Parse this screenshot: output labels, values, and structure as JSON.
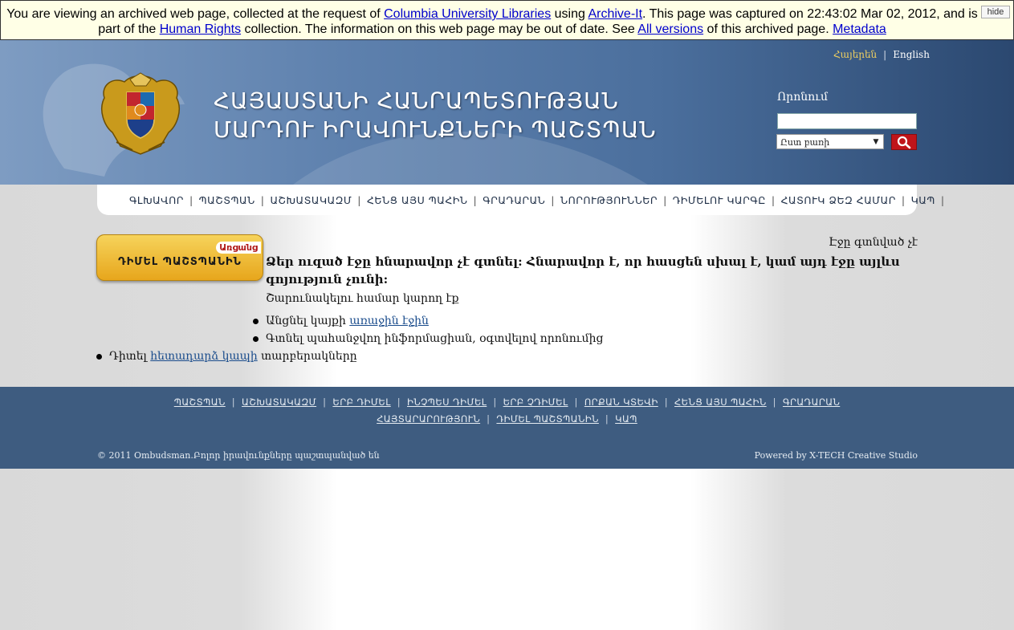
{
  "archive_banner": {
    "text_1": "You are viewing an archived web page, collected at the request of ",
    "link_columbia": "Columbia University Libraries",
    "text_2": " using ",
    "link_archiveit": "Archive-It",
    "text_3": ". This page was captured on 22:43:02 Mar 02, 2012, and is part of the ",
    "link_collection": "Human Rights",
    "text_4": " collection. The information on this web page may be out of date. See ",
    "link_versions": "All versions",
    "text_5": " of this archived page. ",
    "link_metadata": "Metadata",
    "hide_label": "hide"
  },
  "header": {
    "lang_hy": "Հայերեն",
    "lang_sep": "|",
    "lang_en": "English",
    "title_line1": "ՀԱՅԱՍՏԱՆԻ ՀԱՆՐԱՊԵՏՈՒԹՅԱՆ",
    "title_line2": "ՄԱՐԴՈՒ ԻՐԱՎՈՒՆՔՆԵՐԻ ՊԱՇՏՊԱՆ",
    "search_label": "Որոնում",
    "search_value": "",
    "search_select": "Ըստ բառի"
  },
  "nav": {
    "items": [
      "ԳԼԽԱՎՈՐ",
      "ՊԱՇՏՊԱՆ",
      "ԱՇԽԱՏԱԿԱԶՄ",
      "ՀԵՆՑ ԱՅՍ ՊԱՀԻՆ",
      "ԳՐԱԴԱՐԱՆ",
      "ՆՈՐՈՒԹՅՈՒՆՆԵՐ",
      "ԴԻՄԵԼՈՒ ԿԱՐԳԸ",
      "ՀԱՏՈՒԿ ՁԵԶ ՀԱՄԱՐ",
      "ԿԱՊ"
    ],
    "separator": "|"
  },
  "badge": {
    "tag": "Առցանց",
    "label": "ԴԻՄԵԼ ՊԱՇՏՊԱՆԻՆ"
  },
  "content": {
    "crumb": "Էջը գտնված չէ",
    "main_message": "Ձեր ուզած էջը հնարավոր չէ գտնել: Հնարավոր է, որ հասցեն սխալ է, կամ այդ էջը այլևս գոյություն չունի:",
    "sub_message": "Շարունակելու համար կարող էք",
    "opt1_prefix": "Անցնել կայքի ",
    "opt1_link": "առաջին էջին",
    "opt2": "Գտնել պահանջվող ինֆորմացիան, օգտվելով որոնումից",
    "opt3_prefix": "Դիտել ",
    "opt3_link": "հետադարձ կապի",
    "opt3_suffix": " տարբերակները"
  },
  "footer": {
    "row1": [
      "ՊԱՇՏՊԱՆ",
      "ԱՇԽԱՏԱԿԱԶՄ",
      "ԵՐԲ ԴԻՄԵԼ",
      "ԻՆՉՊԵՍ ԴԻՄԵԼ",
      "ԵՐԲ ՉԴԻՄԵԼ",
      "ՈՐՔԱՆ ԿՏԵՎԻ",
      "ՀԵՆՑ ԱՅՍ ՊԱՀԻՆ",
      "ԳՐԱԴԱՐԱՆ"
    ],
    "row2": [
      "ՀԱՅՏԱՐԱՐՈՒԹՅՈՒՆ",
      "ԴԻՄԵԼ ՊԱՇՏՊԱՆԻՆ",
      "ԿԱՊ"
    ],
    "separator": "|",
    "copyright": "© 2011 Ombudsman.Բոլոր իրավունքները պաշտպանված են",
    "powered": "Powered by X-TECH Creative Studio"
  },
  "colors": {
    "banner_bg": "#ffffe6",
    "header_blue": "#4b6f9d",
    "footer_blue": "#3e5c80",
    "badge_gold": "#e7a61c",
    "search_button_red": "#c0141a"
  },
  "icons": {
    "emblem": "coat-of-arms-icon",
    "search_button": "magnifier-icon",
    "select_arrow": "chevron-down-icon"
  }
}
